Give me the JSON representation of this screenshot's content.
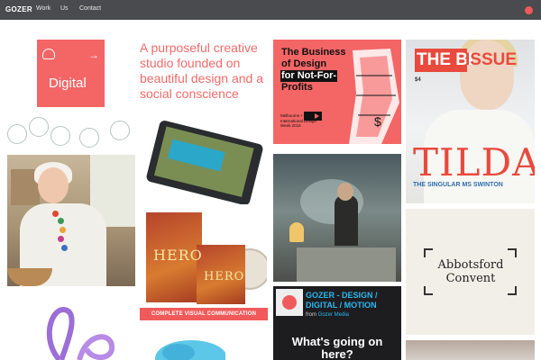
{
  "nav": {
    "logo": "GOZER",
    "links": [
      "Work",
      "Us",
      "Contact"
    ],
    "menu_dot_color": "#f05a5a"
  },
  "tiles": {
    "digital": {
      "label": "Digital",
      "color": "#f46565"
    },
    "tagline": "A purposeful creative studio founded on beautiful design and a social conscience",
    "poster": {
      "title_lines": [
        "The Business",
        "of Design",
        "for Not-For-",
        "Profits"
      ],
      "subtitle": "Melbourne + International Design Week 2016"
    },
    "magazine": {
      "brand": "THE BI",
      "brand_rest": "ISSUE",
      "price": "$4",
      "headline": "TILDA",
      "caption": "THE SINGULAR MS SWINTON"
    },
    "hero": {
      "book_title": "HERO",
      "service_label": "COMPLETE VISUAL COMMUNICATION SERVICE"
    },
    "video": {
      "title": "GOZER - DESIGN / DIGITAL / MOTION",
      "from_prefix": "from",
      "from_channel": "Gozer Media",
      "headline": "What's going on here?"
    },
    "abbotsford": {
      "name_line1": "Abbotsford",
      "name_line2": "Convent"
    }
  }
}
